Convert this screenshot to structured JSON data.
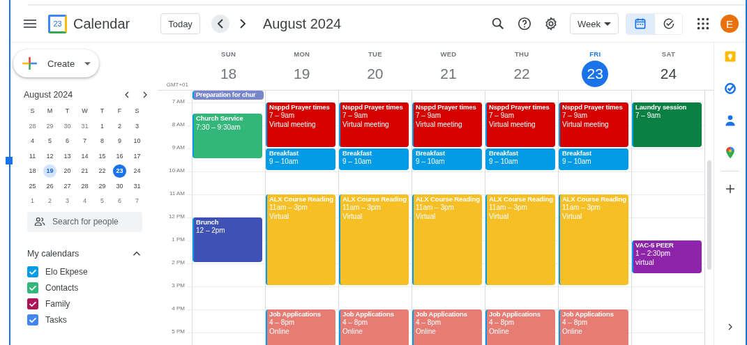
{
  "header": {
    "app_name": "Calendar",
    "logo_day": "23",
    "today_button": "Today",
    "title": "August 2024",
    "view_select": "Week",
    "view_toggle": [
      {
        "kind": "calendar",
        "selected": true
      },
      {
        "kind": "tasks",
        "selected": false
      }
    ],
    "avatar": "E"
  },
  "sidebar": {
    "create": "Create",
    "mini_calendar": {
      "title": "August 2024",
      "weekdays": [
        "S",
        "M",
        "T",
        "W",
        "T",
        "F",
        "S"
      ],
      "weeks": [
        [
          {
            "label": "28",
            "muted": true,
            "selected": false,
            "today": false
          },
          {
            "label": "29",
            "muted": true,
            "selected": false,
            "today": false
          },
          {
            "label": "30",
            "muted": true,
            "selected": false,
            "today": false
          },
          {
            "label": "31",
            "muted": true,
            "selected": false,
            "today": false
          },
          {
            "label": "1",
            "muted": false,
            "selected": false,
            "today": false
          },
          {
            "label": "2",
            "muted": false,
            "selected": false,
            "today": false
          },
          {
            "label": "3",
            "muted": false,
            "selected": false,
            "today": false
          }
        ],
        [
          {
            "label": "4",
            "muted": false,
            "selected": false,
            "today": false
          },
          {
            "label": "5",
            "muted": false,
            "selected": false,
            "today": false
          },
          {
            "label": "6",
            "muted": false,
            "selected": false,
            "today": false
          },
          {
            "label": "7",
            "muted": false,
            "selected": false,
            "today": false
          },
          {
            "label": "8",
            "muted": false,
            "selected": false,
            "today": false
          },
          {
            "label": "9",
            "muted": false,
            "selected": false,
            "today": false
          },
          {
            "label": "10",
            "muted": false,
            "selected": false,
            "today": false
          }
        ],
        [
          {
            "label": "11",
            "muted": false,
            "selected": false,
            "today": false
          },
          {
            "label": "12",
            "muted": false,
            "selected": false,
            "today": false
          },
          {
            "label": "13",
            "muted": false,
            "selected": false,
            "today": false
          },
          {
            "label": "14",
            "muted": false,
            "selected": false,
            "today": false
          },
          {
            "label": "15",
            "muted": false,
            "selected": false,
            "today": false
          },
          {
            "label": "16",
            "muted": false,
            "selected": false,
            "today": false
          },
          {
            "label": "17",
            "muted": false,
            "selected": false,
            "today": false
          }
        ],
        [
          {
            "label": "18",
            "muted": false,
            "selected": false,
            "today": false
          },
          {
            "label": "19",
            "muted": false,
            "selected": true,
            "today": false
          },
          {
            "label": "20",
            "muted": false,
            "selected": false,
            "today": false
          },
          {
            "label": "21",
            "muted": false,
            "selected": false,
            "today": false
          },
          {
            "label": "22",
            "muted": false,
            "selected": false,
            "today": false
          },
          {
            "label": "23",
            "muted": false,
            "selected": false,
            "today": true
          },
          {
            "label": "24",
            "muted": false,
            "selected": false,
            "today": false
          }
        ],
        [
          {
            "label": "25",
            "muted": false,
            "selected": false,
            "today": false
          },
          {
            "label": "26",
            "muted": false,
            "selected": false,
            "today": false
          },
          {
            "label": "27",
            "muted": false,
            "selected": false,
            "today": false
          },
          {
            "label": "28",
            "muted": false,
            "selected": false,
            "today": false
          },
          {
            "label": "29",
            "muted": false,
            "selected": false,
            "today": false
          },
          {
            "label": "30",
            "muted": false,
            "selected": false,
            "today": false
          },
          {
            "label": "31",
            "muted": false,
            "selected": false,
            "today": false
          }
        ],
        [
          {
            "label": "1",
            "muted": true,
            "selected": false,
            "today": false
          },
          {
            "label": "2",
            "muted": true,
            "selected": false,
            "today": false
          },
          {
            "label": "3",
            "muted": true,
            "selected": false,
            "today": false
          },
          {
            "label": "4",
            "muted": true,
            "selected": false,
            "today": false
          },
          {
            "label": "5",
            "muted": true,
            "selected": false,
            "today": false
          },
          {
            "label": "6",
            "muted": true,
            "selected": false,
            "today": false
          },
          {
            "label": "7",
            "muted": true,
            "selected": false,
            "today": false
          }
        ]
      ]
    },
    "search_people": {
      "placeholder": "Search for people"
    },
    "my_calendars": {
      "title": "My calendars",
      "expanded": true,
      "items": [
        {
          "label": "Elo Ekpese",
          "color": "#039be5",
          "checked": true
        },
        {
          "label": "Contacts",
          "color": "#33b679",
          "checked": true
        },
        {
          "label": "Family",
          "color": "#ad1457",
          "checked": true
        },
        {
          "label": "Tasks",
          "color": "#4285f4",
          "checked": true
        }
      ]
    }
  },
  "week": {
    "timezone": "GMT+01",
    "hours": [
      "7 AM",
      "8 AM",
      "9 AM",
      "10 AM",
      "11 AM",
      "12 PM",
      "1 PM",
      "2 PM",
      "3 PM",
      "4 PM",
      "5 PM"
    ],
    "days": [
      {
        "weekday": "SUN",
        "date": "18",
        "past": true,
        "today": false,
        "events": [
          {
            "title": "Preparation for chur",
            "color": "#7986cb"
          },
          {
            "title": "Church Service",
            "time": "7:30 – 9:30am",
            "color": "#33b679"
          },
          {
            "title": "Brunch",
            "time": "12 – 2pm",
            "color": "#3f51b5"
          }
        ]
      },
      {
        "weekday": "MON",
        "date": "19",
        "past": true,
        "today": false,
        "events": [
          {
            "title": "Nsppd Prayer times",
            "time": "7 – 9am",
            "details": [
              "Virtual meeting"
            ],
            "color": "#d50000"
          },
          {
            "title": "Breakfast",
            "time": "9 – 10am",
            "color": "#039be5"
          },
          {
            "title": "ALX Course Reading",
            "time": "11am – 3pm",
            "details": [
              "Virtual"
            ],
            "color": "#f6bf26"
          },
          {
            "title": "Job Applications",
            "time": "4 – 8pm",
            "details": [
              "Online"
            ],
            "color": "#e67c73"
          }
        ]
      },
      {
        "weekday": "TUE",
        "date": "20",
        "past": true,
        "today": false,
        "events": [
          {
            "title": "Nsppd Prayer times",
            "time": "7 – 9am",
            "details": [
              "Virtual meeting"
            ],
            "color": "#d50000"
          },
          {
            "title": "Breakfast",
            "time": "9 – 10am",
            "color": "#039be5"
          },
          {
            "title": "ALX Course Reading",
            "time": "11am – 3pm",
            "details": [
              "Virtual"
            ],
            "color": "#f6bf26"
          },
          {
            "title": "Job Applications",
            "time": "4 – 8pm",
            "details": [
              "Online"
            ],
            "color": "#e67c73"
          }
        ]
      },
      {
        "weekday": "WED",
        "date": "21",
        "past": true,
        "today": false,
        "events": [
          {
            "title": "Nsppd Prayer times",
            "time": "7 – 9am",
            "details": [
              "Virtual meeting"
            ],
            "color": "#d50000"
          },
          {
            "title": "Breakfast",
            "time": "9 – 10am",
            "color": "#039be5"
          },
          {
            "title": "ALX Course Reading",
            "time": "11am – 3pm",
            "details": [
              "Virtual"
            ],
            "color": "#f6bf26"
          },
          {
            "title": "Job Applications",
            "time": "4 – 8pm",
            "details": [
              "Online"
            ],
            "color": "#e67c73"
          }
        ]
      },
      {
        "weekday": "THU",
        "date": "22",
        "past": true,
        "today": false,
        "events": [
          {
            "title": "Nsppd Prayer times",
            "time": "7 – 9am",
            "details": [
              "Virtual meeting"
            ],
            "color": "#d50000"
          },
          {
            "title": "Breakfast",
            "time": "9 – 10am",
            "color": "#039be5"
          },
          {
            "title": "ALX Course Reading",
            "time": "11am – 3pm",
            "details": [
              "Virtual"
            ],
            "color": "#f6bf26"
          },
          {
            "title": "Job Applications",
            "time": "4 – 8pm",
            "details": [
              "Online"
            ],
            "color": "#e67c73"
          }
        ]
      },
      {
        "weekday": "FRI",
        "date": "23",
        "past": false,
        "today": true,
        "events": [
          {
            "title": "Nsppd Prayer times",
            "time": "7 – 9am",
            "details": [
              "Virtual meeting"
            ],
            "color": "#d50000"
          },
          {
            "title": "Breakfast",
            "time": "9 – 10am",
            "color": "#039be5"
          },
          {
            "title": "ALX Course Reading",
            "time": "11am – 3pm",
            "details": [
              "Virtual"
            ],
            "color": "#f6bf26"
          },
          {
            "title": "Job Applications",
            "time": "4 – 8pm",
            "details": [
              "Online"
            ],
            "color": "#e67c73"
          }
        ]
      },
      {
        "weekday": "SAT",
        "date": "24",
        "past": false,
        "today": false,
        "events": [
          {
            "title": "Laundry session",
            "time": "7 – 9am",
            "color": "#0b8043"
          },
          {
            "title": "VAC-5 PEER",
            "time": "1 – 2:30pm",
            "details": [
              "virtual"
            ],
            "color": "#8e24aa"
          }
        ]
      }
    ]
  }
}
